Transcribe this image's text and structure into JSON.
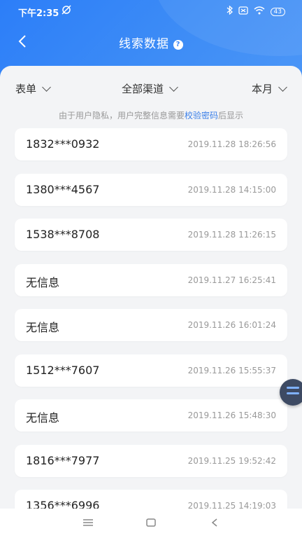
{
  "status_bar": {
    "time": "下午2:35",
    "battery": "43"
  },
  "nav": {
    "title": "线索数据"
  },
  "filters": {
    "form": "表单",
    "channel": "全部渠道",
    "period": "本月"
  },
  "notice": {
    "before": "由于用户隐私，用户完整信息需要",
    "link": "校验密码",
    "after": "后显示"
  },
  "leads": [
    {
      "contact": "1832***0932",
      "time": "2019.11.28 18:26:56"
    },
    {
      "contact": "1380***4567",
      "time": "2019.11.28 14:15:00"
    },
    {
      "contact": "1538***8708",
      "time": "2019.11.28 11:26:15"
    },
    {
      "contact": "无信息",
      "time": "2019.11.27 16:25:41"
    },
    {
      "contact": "无信息",
      "time": "2019.11.26 16:01:24"
    },
    {
      "contact": "1512***7607",
      "time": "2019.11.26 15:55:37"
    },
    {
      "contact": "无信息",
      "time": "2019.11.26 15:48:30"
    },
    {
      "contact": "1816***7977",
      "time": "2019.11.25 19:52:42"
    },
    {
      "contact": "1356***6996",
      "time": "2019.11.25 14:19:03"
    }
  ],
  "colors": {
    "accent": "#2f80f7",
    "link": "#3b7fe8"
  },
  "icons": {
    "back": "back-arrow-icon",
    "help": "help-icon",
    "float": "floating-assistant-icon"
  }
}
